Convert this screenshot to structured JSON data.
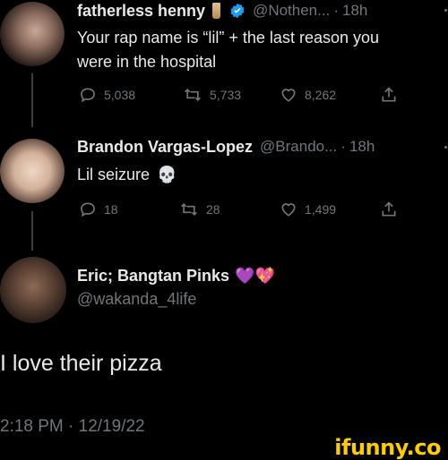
{
  "tweets": [
    {
      "display_name": "fatherless henny",
      "handle": "@Nothen...",
      "time": "18h",
      "text_line1": "Your rap name is “lil” + the last reason you",
      "text_line2": "were in the hospital",
      "replies": "5,038",
      "retweets": "5,733",
      "likes": "8,262"
    },
    {
      "display_name": "Brandon Vargas-Lopez",
      "handle": "@Brando...",
      "time": "18h",
      "text": "Lil seizure",
      "emoji": "💀",
      "replies": "18",
      "retweets": "28",
      "likes": "1,499"
    }
  ],
  "main_tweet": {
    "display_name": "Eric; Bangtan Pinks",
    "emoji": "💜💖",
    "handle": "@wakanda_4life",
    "text": "I love their pizza",
    "timestamp": "2:18 PM · 12/19/22"
  },
  "separator": "·",
  "watermark": "ifunny.co",
  "colors": {
    "background": "#000000",
    "text": "#e7e9ea",
    "muted": "#71767b",
    "verified": "#1d9bf0",
    "watermark": "#ffcc00"
  }
}
